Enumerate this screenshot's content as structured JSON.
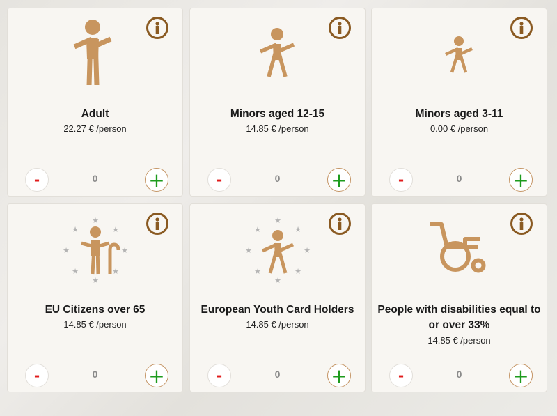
{
  "colors": {
    "accent": "#c8955e",
    "info": "#8a5a22",
    "minus": "#e11b1b",
    "plus": "#1d9b1d",
    "count": "#8a8a8a"
  },
  "cards": [
    {
      "title": "Adult",
      "price": "22.27 € /person",
      "count": "0",
      "minus_label": "-",
      "plus_label": "+",
      "icon": "adult-icon"
    },
    {
      "title": "Minors aged 12-15",
      "price": "14.85 € /person",
      "count": "0",
      "minus_label": "-",
      "plus_label": "+",
      "icon": "minor-12-15-icon"
    },
    {
      "title": "Minors aged 3-11",
      "price": "0.00 € /person",
      "count": "0",
      "minus_label": "-",
      "plus_label": "+",
      "icon": "minor-3-11-icon"
    },
    {
      "title": "EU Citizens over 65",
      "price": "14.85 € /person",
      "count": "0",
      "minus_label": "-",
      "plus_label": "+",
      "icon": "senior-eu-icon"
    },
    {
      "title": "European Youth Card Holders",
      "price": "14.85 € /person",
      "count": "0",
      "minus_label": "-",
      "plus_label": "+",
      "icon": "youth-card-icon"
    },
    {
      "title": "People with disabilities equal to or over 33%",
      "price": "14.85 € /person",
      "count": "0",
      "minus_label": "-",
      "plus_label": "+",
      "icon": "wheelchair-icon"
    }
  ]
}
